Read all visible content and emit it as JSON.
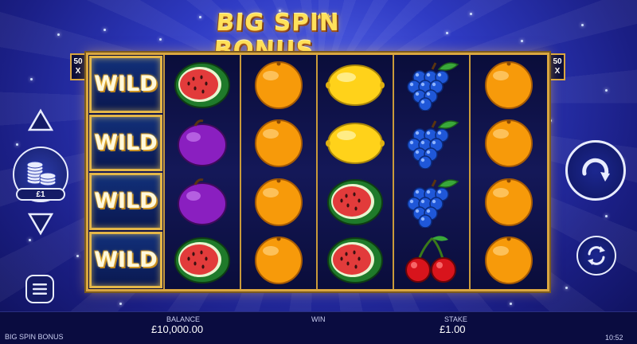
{
  "game": {
    "logo_text": "BIG SPIN BONUS",
    "title": "BIG SPIN BONUS",
    "clock": "10:52"
  },
  "multipliers": {
    "left": [
      "50",
      "X"
    ],
    "right": [
      "50",
      "X"
    ]
  },
  "reels": [
    [
      "wild",
      "wild",
      "wild",
      "wild"
    ],
    [
      "watermelon",
      "plum",
      "plum",
      "watermelon"
    ],
    [
      "orange",
      "orange",
      "orange",
      "orange"
    ],
    [
      "lemon",
      "lemon",
      "watermelon",
      "watermelon"
    ],
    [
      "grapes",
      "grapes",
      "grapes",
      "cherries"
    ],
    [
      "orange",
      "orange",
      "orange",
      "orange"
    ]
  ],
  "wild_label": "WILD",
  "controls": {
    "stake_value": "£1",
    "up_icon": "triangle-up-icon",
    "down_icon": "triangle-down-icon",
    "coins_icon": "coin-stack-icon",
    "menu_icon": "hamburger-menu-icon",
    "spin_icon": "spin-arrow-icon",
    "autoplay_icon": "autoplay-cycle-icon"
  },
  "bottom_bar": {
    "balance_label": "BALANCE",
    "balance_value": "£10,000.00",
    "win_label": "WIN",
    "win_value": "",
    "stake_label": "STAKE",
    "stake_value": "£1.00"
  },
  "colors": {
    "frame_gold": "#d9a640",
    "background_blue": "#2f3bc4",
    "bar_dark": "#0a0c40"
  }
}
